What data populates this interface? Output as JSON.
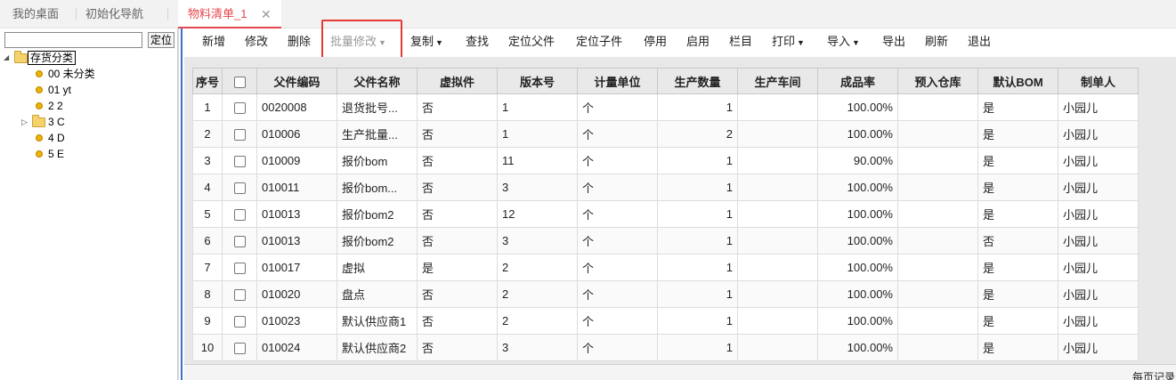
{
  "tabs": [
    {
      "label": "我的桌面"
    },
    {
      "label": "初始化导航"
    },
    {
      "label": "物料清单_1",
      "active": true
    }
  ],
  "left_panel": {
    "search_value": "",
    "locate_label": "定位",
    "tree": {
      "root_label": "存货分类",
      "items": [
        {
          "label": "00 未分类",
          "type": "leaf"
        },
        {
          "label": "01 yt",
          "type": "leaf"
        },
        {
          "label": "2 2",
          "type": "leaf"
        },
        {
          "label": "3 C",
          "type": "folder"
        },
        {
          "label": "4 D",
          "type": "leaf"
        },
        {
          "label": "5 E",
          "type": "leaf"
        }
      ]
    }
  },
  "toolbar": {
    "buttons": [
      {
        "label": "新增"
      },
      {
        "label": "修改"
      },
      {
        "label": "删除"
      },
      {
        "label": "批量修改",
        "dropdown": true,
        "disabled": true
      },
      {
        "label": "复制",
        "dropdown": true
      },
      {
        "label": "查找"
      },
      {
        "label": "定位父件"
      },
      {
        "label": "定位子件"
      },
      {
        "label": "停用"
      },
      {
        "label": "启用"
      },
      {
        "label": "栏目"
      },
      {
        "label": "打印",
        "dropdown": true
      },
      {
        "label": "导入",
        "dropdown": true
      },
      {
        "label": "导出"
      },
      {
        "label": "刷新"
      },
      {
        "label": "退出"
      }
    ]
  },
  "grid": {
    "columns": [
      "序号",
      "",
      "父件编码",
      "父件名称",
      "虚拟件",
      "版本号",
      "计量单位",
      "生产数量",
      "生产车间",
      "成品率",
      "预入仓库",
      "默认BOM",
      "制单人"
    ],
    "rows": [
      {
        "no": "1",
        "code": "0020008",
        "name": "退货批号...",
        "virtual": "否",
        "version": "1",
        "unit": "个",
        "qty": "1",
        "workshop": "",
        "yield": "100.00%",
        "warehouse": "",
        "default_bom": "是",
        "creator": "小园儿"
      },
      {
        "no": "2",
        "code": "010006",
        "name": "生产批量...",
        "virtual": "否",
        "version": "1",
        "unit": "个",
        "qty": "2",
        "workshop": "",
        "yield": "100.00%",
        "warehouse": "",
        "default_bom": "是",
        "creator": "小园儿"
      },
      {
        "no": "3",
        "code": "010009",
        "name": "报价bom",
        "virtual": "否",
        "version": "11",
        "unit": "个",
        "qty": "1",
        "workshop": "",
        "yield": "90.00%",
        "warehouse": "",
        "default_bom": "是",
        "creator": "小园儿"
      },
      {
        "no": "4",
        "code": "010011",
        "name": "报价bom...",
        "virtual": "否",
        "version": "3",
        "unit": "个",
        "qty": "1",
        "workshop": "",
        "yield": "100.00%",
        "warehouse": "",
        "default_bom": "是",
        "creator": "小园儿"
      },
      {
        "no": "5",
        "code": "010013",
        "name": "报价bom2",
        "virtual": "否",
        "version": "12",
        "unit": "个",
        "qty": "1",
        "workshop": "",
        "yield": "100.00%",
        "warehouse": "",
        "default_bom": "是",
        "creator": "小园儿"
      },
      {
        "no": "6",
        "code": "010013",
        "name": "报价bom2",
        "virtual": "否",
        "version": "3",
        "unit": "个",
        "qty": "1",
        "workshop": "",
        "yield": "100.00%",
        "warehouse": "",
        "default_bom": "否",
        "creator": "小园儿"
      },
      {
        "no": "7",
        "code": "010017",
        "name": "虚拟",
        "virtual": "是",
        "version": "2",
        "unit": "个",
        "qty": "1",
        "workshop": "",
        "yield": "100.00%",
        "warehouse": "",
        "default_bom": "是",
        "creator": "小园儿"
      },
      {
        "no": "8",
        "code": "010020",
        "name": "盘点",
        "virtual": "否",
        "version": "2",
        "unit": "个",
        "qty": "1",
        "workshop": "",
        "yield": "100.00%",
        "warehouse": "",
        "default_bom": "是",
        "creator": "小园儿"
      },
      {
        "no": "9",
        "code": "010023",
        "name": "默认供应商1",
        "virtual": "否",
        "version": "2",
        "unit": "个",
        "qty": "1",
        "workshop": "",
        "yield": "100.00%",
        "warehouse": "",
        "default_bom": "是",
        "creator": "小园儿"
      },
      {
        "no": "10",
        "code": "010024",
        "name": "默认供应商2",
        "virtual": "否",
        "version": "3",
        "unit": "个",
        "qty": "1",
        "workshop": "",
        "yield": "100.00%",
        "warehouse": "",
        "default_bom": "是",
        "creator": "小园儿"
      }
    ]
  },
  "footer": {
    "text": "每页记录"
  },
  "colors": {
    "active_tab": "#e5484d",
    "highlight_box": "#e53935",
    "splitter": "#3b6fd1"
  }
}
